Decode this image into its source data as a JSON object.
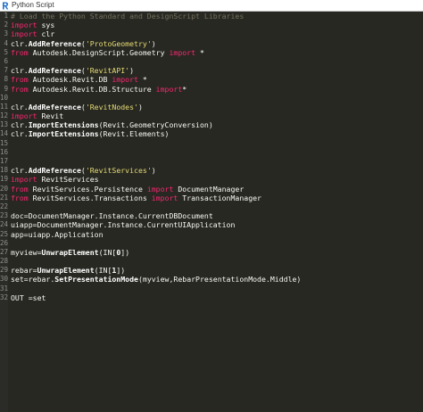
{
  "window": {
    "title": "Python Script",
    "app_icon": "revit-r-icon",
    "accent_color": "#1f6fc5"
  },
  "editor": {
    "theme": {
      "background": "#272822",
      "keyword": "#f92672",
      "string": "#e6db74",
      "comment": "#75715e",
      "plain": "#f8f8f2",
      "line_number": "#8f908a"
    },
    "lines": [
      {
        "num": "1",
        "tokens": [
          {
            "t": "# Load the Python Standard and DesignScript Libraries",
            "c": "cm"
          }
        ]
      },
      {
        "num": "2",
        "tokens": [
          {
            "t": "import",
            "c": "kw"
          },
          {
            "t": " sys",
            "c": "pl"
          }
        ]
      },
      {
        "num": "3",
        "tokens": [
          {
            "t": "import",
            "c": "kw"
          },
          {
            "t": " clr",
            "c": "pl"
          }
        ]
      },
      {
        "num": "4",
        "tokens": [
          {
            "t": "clr.",
            "c": "pl"
          },
          {
            "t": "AddReference",
            "c": "fn"
          },
          {
            "t": "(",
            "c": "pl"
          },
          {
            "t": "'ProtoGeometry'",
            "c": "str"
          },
          {
            "t": ")",
            "c": "pl"
          }
        ]
      },
      {
        "num": "5",
        "tokens": [
          {
            "t": "from",
            "c": "kw"
          },
          {
            "t": " Autodesk.DesignScript.Geometry ",
            "c": "pl"
          },
          {
            "t": "import",
            "c": "kw"
          },
          {
            "t": " *",
            "c": "pl"
          }
        ]
      },
      {
        "num": "6",
        "tokens": []
      },
      {
        "num": "7",
        "tokens": [
          {
            "t": "clr.",
            "c": "pl"
          },
          {
            "t": "AddReference",
            "c": "fn"
          },
          {
            "t": "(",
            "c": "pl"
          },
          {
            "t": "'RevitAPI'",
            "c": "str"
          },
          {
            "t": ")",
            "c": "pl"
          }
        ]
      },
      {
        "num": "8",
        "tokens": [
          {
            "t": "from",
            "c": "kw"
          },
          {
            "t": " Autodesk.Revit.DB ",
            "c": "pl"
          },
          {
            "t": "import",
            "c": "kw"
          },
          {
            "t": " *",
            "c": "pl"
          }
        ]
      },
      {
        "num": "9",
        "tokens": [
          {
            "t": "from",
            "c": "kw"
          },
          {
            "t": " Autodesk.Revit.DB.Structure ",
            "c": "pl"
          },
          {
            "t": "import",
            "c": "kw"
          },
          {
            "t": "*",
            "c": "pl"
          }
        ]
      },
      {
        "num": "10",
        "tokens": []
      },
      {
        "num": "11",
        "tokens": [
          {
            "t": "clr.",
            "c": "pl"
          },
          {
            "t": "AddReference",
            "c": "fn"
          },
          {
            "t": "(",
            "c": "pl"
          },
          {
            "t": "'RevitNodes'",
            "c": "str"
          },
          {
            "t": ")",
            "c": "pl"
          }
        ]
      },
      {
        "num": "12",
        "tokens": [
          {
            "t": "import",
            "c": "kw"
          },
          {
            "t": " Revit",
            "c": "pl"
          }
        ]
      },
      {
        "num": "13",
        "tokens": [
          {
            "t": "clr.",
            "c": "pl"
          },
          {
            "t": "ImportExtensions",
            "c": "fn"
          },
          {
            "t": "(Revit.GeometryConversion)",
            "c": "pl"
          }
        ]
      },
      {
        "num": "14",
        "tokens": [
          {
            "t": "clr.",
            "c": "pl"
          },
          {
            "t": "ImportExtensions",
            "c": "fn"
          },
          {
            "t": "(Revit.Elements)",
            "c": "pl"
          }
        ]
      },
      {
        "num": "15",
        "tokens": []
      },
      {
        "num": "16",
        "tokens": []
      },
      {
        "num": "17",
        "tokens": []
      },
      {
        "num": "18",
        "tokens": [
          {
            "t": "clr.",
            "c": "pl"
          },
          {
            "t": "AddReference",
            "c": "fn"
          },
          {
            "t": "(",
            "c": "pl"
          },
          {
            "t": "'RevitServices'",
            "c": "str"
          },
          {
            "t": ")",
            "c": "pl"
          }
        ]
      },
      {
        "num": "19",
        "tokens": [
          {
            "t": "import",
            "c": "kw"
          },
          {
            "t": " RevitServices",
            "c": "pl"
          }
        ]
      },
      {
        "num": "20",
        "tokens": [
          {
            "t": "from",
            "c": "kw"
          },
          {
            "t": " RevitServices.Persistence ",
            "c": "pl"
          },
          {
            "t": "import",
            "c": "kw"
          },
          {
            "t": " DocumentManager",
            "c": "pl"
          }
        ]
      },
      {
        "num": "21",
        "tokens": [
          {
            "t": "from",
            "c": "kw"
          },
          {
            "t": " RevitServices.Transactions ",
            "c": "pl"
          },
          {
            "t": "import",
            "c": "kw"
          },
          {
            "t": " TransactionManager",
            "c": "pl"
          }
        ]
      },
      {
        "num": "22",
        "tokens": []
      },
      {
        "num": "23",
        "tokens": [
          {
            "t": "doc=DocumentManager.Instance.CurrentDBDocument",
            "c": "pl"
          }
        ]
      },
      {
        "num": "24",
        "tokens": [
          {
            "t": "uiapp=DocumentManager.Instance.CurrentUIApplication",
            "c": "pl"
          }
        ]
      },
      {
        "num": "25",
        "tokens": [
          {
            "t": "app=uiapp.Application",
            "c": "pl"
          }
        ]
      },
      {
        "num": "26",
        "tokens": []
      },
      {
        "num": "27",
        "tokens": [
          {
            "t": "myview=",
            "c": "pl"
          },
          {
            "t": "UnwrapElement",
            "c": "fn"
          },
          {
            "t": "(IN[",
            "c": "pl"
          },
          {
            "t": "0",
            "c": "fn"
          },
          {
            "t": "])",
            "c": "pl"
          }
        ]
      },
      {
        "num": "28",
        "tokens": []
      },
      {
        "num": "29",
        "tokens": [
          {
            "t": "rebar=",
            "c": "pl"
          },
          {
            "t": "UnwrapElement",
            "c": "fn"
          },
          {
            "t": "(IN[",
            "c": "pl"
          },
          {
            "t": "1",
            "c": "fn"
          },
          {
            "t": "])",
            "c": "pl"
          }
        ]
      },
      {
        "num": "30",
        "tokens": [
          {
            "t": "set=rebar.",
            "c": "pl"
          },
          {
            "t": "SetPresentationMode",
            "c": "fn"
          },
          {
            "t": "(myview,RebarPresentationMode.Middle)",
            "c": "pl"
          }
        ]
      },
      {
        "num": "31",
        "tokens": []
      },
      {
        "num": "32",
        "tokens": [
          {
            "t": "OUT =set",
            "c": "pl"
          }
        ]
      }
    ]
  }
}
